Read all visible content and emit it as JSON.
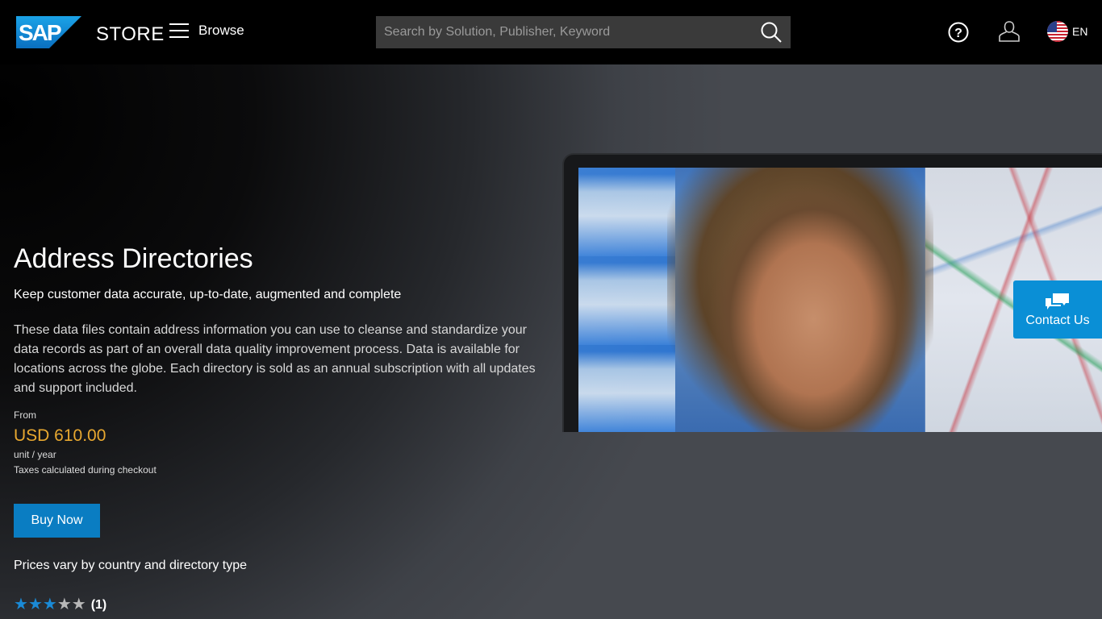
{
  "header": {
    "logo_mark": "SAP",
    "logo_text": "STORE",
    "browse_label": "Browse",
    "search_placeholder": "Search by Solution, Publisher, Keyword",
    "search_value": "",
    "language": "EN",
    "icons": {
      "menu": "hamburger-icon",
      "search": "search-icon",
      "help": "help-icon",
      "user": "user-icon",
      "flag": "us-flag-icon"
    }
  },
  "product": {
    "title": "Address Directories",
    "subtitle": "Keep customer data accurate, up-to-date, augmented and complete",
    "description": "These data files contain address information you can use to cleanse and standardize your data records as part of an overall data quality improvement process. Data is available for locations across the globe. Each directory is sold as an annual subscription with all updates and support included.",
    "price_prefix": "From",
    "price": "USD 610.00",
    "price_unit": "unit / year",
    "tax_note": "Taxes calculated during checkout",
    "buy_label": "Buy Now",
    "price_note": "Prices vary by country and directory type",
    "rating": {
      "stars_filled": 3,
      "stars_total": 5,
      "count_label": "(1)"
    }
  },
  "contact": {
    "label": "Contact Us",
    "icon": "chat-bubbles-icon"
  },
  "colors": {
    "brand_blue": "#0a8fd6",
    "buy_button": "#0a7dc2",
    "price": "#e8a830",
    "star_on": "#1a8ad6",
    "star_off": "#b8b8b8",
    "search_bg": "#3a3a3a"
  }
}
